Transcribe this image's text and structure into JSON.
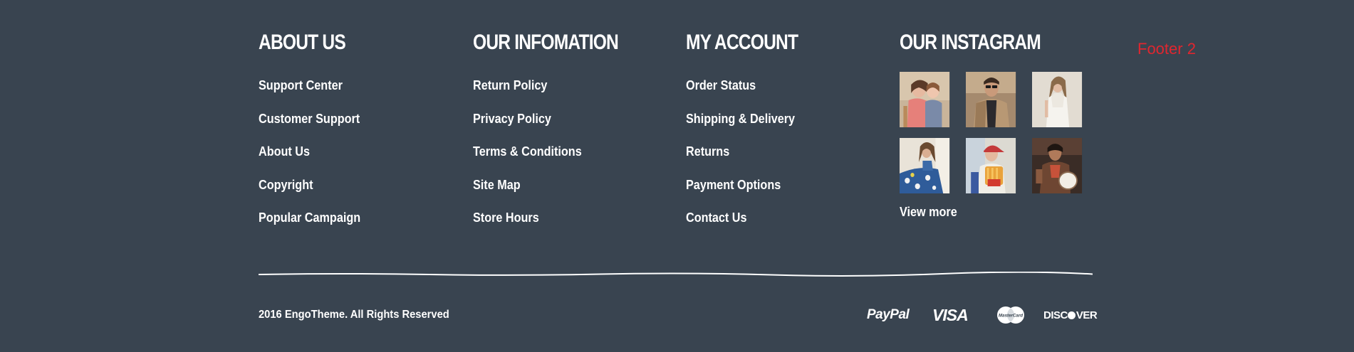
{
  "footer_label": "Footer 2",
  "columns": [
    {
      "title": "About Us",
      "links": [
        "Support Center",
        "Customer Support",
        "About Us",
        "Copyright",
        "Popular Campaign"
      ]
    },
    {
      "title": "Our Infomation",
      "links": [
        "Return Policy",
        "Privacy Policy",
        "Terms & Conditions",
        "Site Map",
        "Store Hours"
      ]
    },
    {
      "title": "My Account",
      "links": [
        "Order Status",
        "Shipping & Delivery",
        "Returns",
        "Payment Options",
        "Contact Us"
      ]
    }
  ],
  "instagram": {
    "title": "Our Instagram",
    "view_more": "View more",
    "photos": [
      "girl-kissing-child-photo",
      "man-sunglasses-photo",
      "woman-white-dress-photo",
      "woman-floral-dress-photo",
      "boy-cap-photo",
      "man-drum-photo"
    ]
  },
  "copyright": "2016 EngoTheme. All Rights Reserved",
  "payments": {
    "paypal": "PayPal",
    "visa": "VISA",
    "mastercard": "MasterCard",
    "discover_a": "DISC",
    "discover_b": "VER"
  },
  "colors": {
    "background": "#394450",
    "text": "#ffffff",
    "tag": "#e0262f"
  }
}
